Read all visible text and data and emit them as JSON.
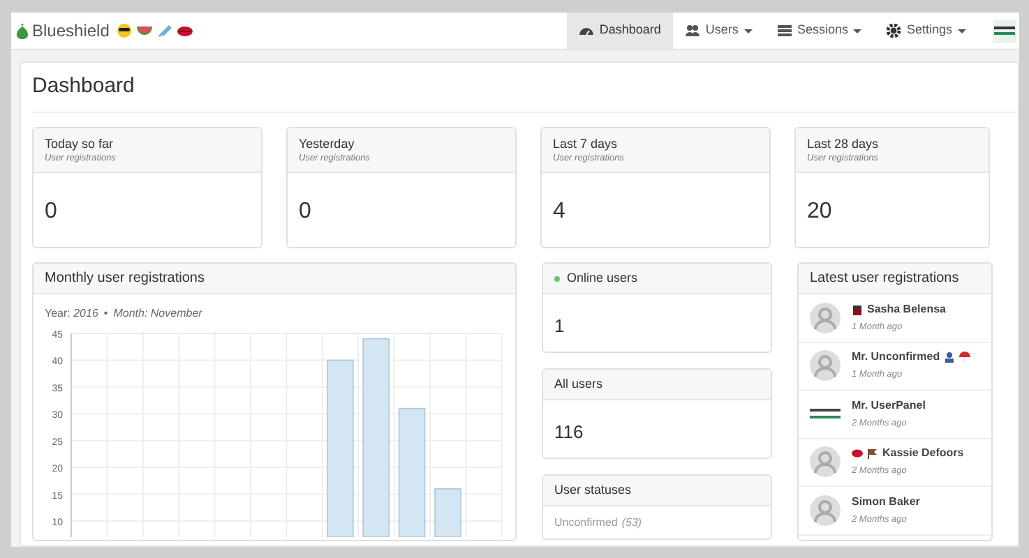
{
  "navbar": {
    "brand": "Blueshield",
    "menu": [
      {
        "label": "Dashboard",
        "selected": true,
        "kind": "dashboard",
        "dropdown": false
      },
      {
        "label": "Users",
        "selected": false,
        "kind": "users",
        "dropdown": true
      },
      {
        "label": "Sessions",
        "selected": false,
        "kind": "sessions",
        "dropdown": true
      },
      {
        "label": "Settings",
        "selected": false,
        "kind": "settings",
        "dropdown": true
      }
    ]
  },
  "page_title": "Dashboard",
  "stat_cards": [
    {
      "title": "Today so far",
      "subtitle": "User registrations",
      "value": "0"
    },
    {
      "title": "Yesterday",
      "subtitle": "User registrations",
      "value": "0"
    },
    {
      "title": "Last 7 days",
      "subtitle": "User registrations",
      "value": "4"
    },
    {
      "title": "Last 28 days",
      "subtitle": "User registrations",
      "value": "20"
    }
  ],
  "monthly_chart": {
    "title": "Monthly user registrations",
    "year_label": "Year:",
    "year": "2016",
    "separator": "•",
    "month_label": "Month:",
    "month": "November",
    "chart_data": {
      "type": "bar",
      "series": [
        {
          "color": "#d4e6f1",
          "values": [
            null,
            null,
            null,
            null,
            null,
            null,
            null,
            40,
            44,
            31,
            16,
            null
          ]
        }
      ],
      "ylim": [
        7,
        45
      ],
      "yticks": [
        10,
        15,
        20,
        25,
        30,
        35,
        40,
        45
      ],
      "grid": true
    }
  },
  "online_users": {
    "title": "Online users",
    "value": "1"
  },
  "all_users": {
    "title": "All users",
    "value": "116"
  },
  "user_statuses": {
    "title": "User statuses",
    "items": [
      {
        "label": "Unconfirmed",
        "count": "(53)"
      }
    ]
  },
  "latest_registrations": {
    "title": "Latest user registrations",
    "users": [
      {
        "name": "Sasha Belensa",
        "time": "1 Month ago",
        "kind": "default",
        "badges_before": [
          {
            "kind": "mug"
          }
        ]
      },
      {
        "name": "Mr. Unconfirmed",
        "time": "1 Month ago",
        "kind": "default",
        "badges_after": [
          {
            "kind": "person"
          },
          {
            "kind": "mushroom"
          }
        ]
      },
      {
        "name": "Mr. UserPanel",
        "time": "2 Months ago",
        "kind": "logo"
      },
      {
        "name": "Kassie Defoors",
        "time": "2 Months ago",
        "kind": "default",
        "badges_before": [
          {
            "kind": "lips"
          },
          {
            "kind": "flag"
          }
        ]
      },
      {
        "name": "Simon Baker",
        "time": "2 Months ago",
        "kind": "default"
      }
    ]
  }
}
